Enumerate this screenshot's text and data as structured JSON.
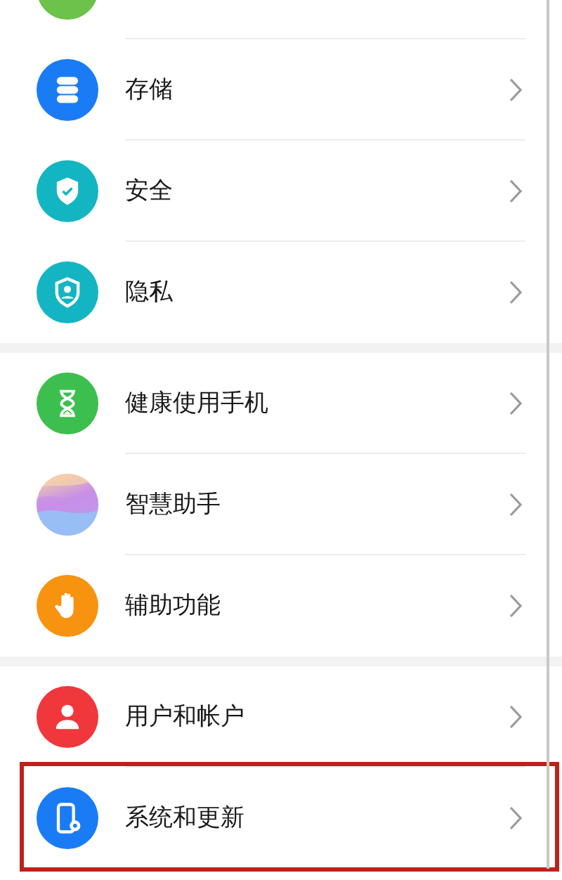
{
  "sections": [
    {
      "items": [
        {
          "kind": "cut",
          "color": "#6cc24a"
        },
        {
          "kind": "row",
          "label": "存储",
          "color": "#1a7cf5",
          "highlighted": false
        },
        {
          "kind": "row",
          "label": "安全",
          "color": "#14b5c2",
          "highlighted": false
        },
        {
          "kind": "row",
          "label": "隐私",
          "color": "#14b5c2",
          "highlighted": false
        }
      ]
    },
    {
      "items": [
        {
          "kind": "row",
          "label": "健康使用手机",
          "color": "#3cbf4e",
          "highlighted": false
        },
        {
          "kind": "row",
          "label": "智慧助手",
          "color": "#c88ee8",
          "highlighted": false
        },
        {
          "kind": "row",
          "label": "辅助功能",
          "color": "#f7930f",
          "highlighted": false
        }
      ]
    },
    {
      "items": [
        {
          "kind": "row",
          "label": "用户和帐户",
          "color": "#f0373c",
          "highlighted": false
        },
        {
          "kind": "row",
          "label": "系统和更新",
          "color": "#1a7cf5",
          "highlighted": true
        }
      ]
    }
  ]
}
